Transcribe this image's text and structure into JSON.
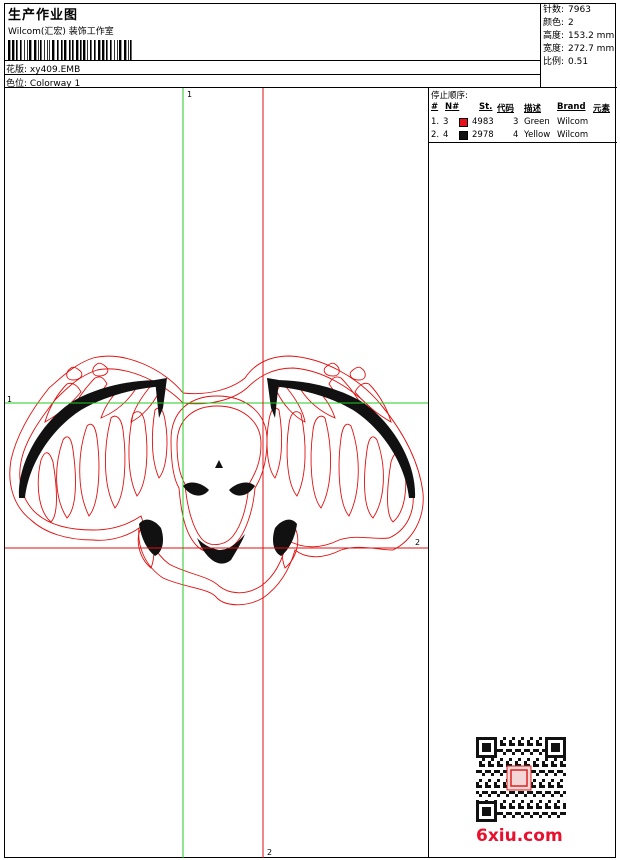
{
  "header": {
    "title": "生产作业图",
    "company": "Wilcom(汇宏) 装饰工作室",
    "file_label": "花版:",
    "file_value": "xy409.EMB",
    "colorway_label": "色位:",
    "colorway_value": "Colorway 1"
  },
  "stats": [
    {
      "label": "针数:",
      "value": "7963"
    },
    {
      "label": "颜色:",
      "value": "2"
    },
    {
      "label": "高度:",
      "value": "153.2 mm"
    },
    {
      "label": "宽度:",
      "value": "272.7 mm"
    },
    {
      "label": "比例:",
      "value": "0.51"
    }
  ],
  "stop_sequence": {
    "title": "停止顺序:",
    "headers": [
      "#",
      "N#",
      "St.",
      "代码",
      "描述",
      "Brand",
      "元素"
    ],
    "rows": [
      {
        "idx": "1.",
        "n": "3",
        "color": "#e8101a",
        "stitches": "4983",
        "code": "3",
        "desc": "Green",
        "brand": "Wilcom"
      },
      {
        "idx": "2.",
        "n": "4",
        "color": "#111111",
        "stitches": "2978",
        "code": "4",
        "desc": "Yellow",
        "brand": "Wilcom"
      }
    ]
  },
  "guides": {
    "green_v": "1",
    "green_h": "1",
    "red_v": "2",
    "red_h": "2"
  },
  "watermark": "6xiu.com",
  "colors": {
    "guide_green": "#22cc22",
    "guide_red": "#dd1111",
    "outline": "#e01010",
    "fill": "#111111"
  }
}
